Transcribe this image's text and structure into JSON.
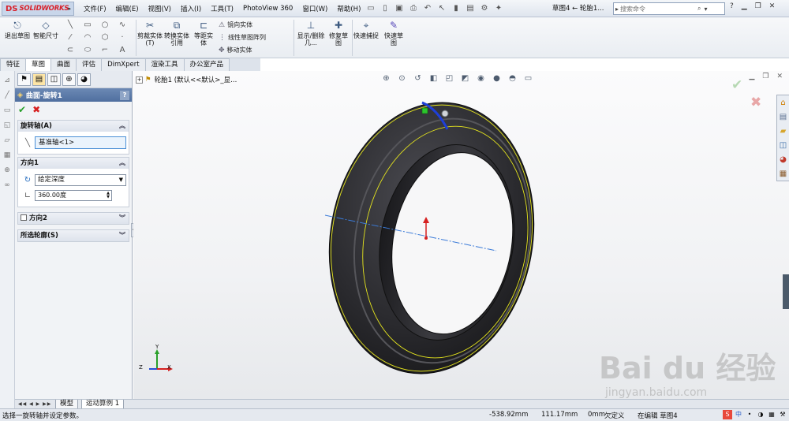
{
  "app": {
    "logo_text": "SOLIDWORKS",
    "logo_mark": "DS"
  },
  "menu": [
    "文件(F)",
    "编辑(E)",
    "视图(V)",
    "插入(I)",
    "工具(T)",
    "PhotoView 360",
    "窗口(W)",
    "帮助(H)"
  ],
  "document_title": "草图4 ← 轮胎1...",
  "search": {
    "placeholder": "搜索命令"
  },
  "ribbon": {
    "exit_sketch": "退出草图",
    "smart_dimension": "智能尺寸",
    "trim_entities": "剪裁实体(T)",
    "convert_entities": "转换实体引用",
    "offset_entities": "等距实体",
    "mirror_entities": "镜向实体",
    "linear_pattern": "线性草图阵列",
    "move_entities": "移动实体",
    "display_delete_relations": "显示/删除几...",
    "repair_sketch": "修复草图",
    "quick_snaps": "快速捕捉",
    "rapid_sketch": "快速草图"
  },
  "tabs": [
    "特征",
    "草图",
    "曲面",
    "评估",
    "DimXpert",
    "渲染工具",
    "办公室产品"
  ],
  "active_tab": "草图",
  "property_manager": {
    "title": "曲面-旋转1",
    "help": "?",
    "rotation_axis": {
      "header": "旋转轴(A)",
      "value": "基准轴<1>"
    },
    "direction1": {
      "header": "方向1",
      "type": "给定深度",
      "angle": "360.00度"
    },
    "direction2": {
      "header": "方向2"
    },
    "selected_contours": {
      "header": "所选轮廓(S)"
    }
  },
  "feature_tree": {
    "root": "轮胎1  (默认<<默认>_显..."
  },
  "triad": {
    "x": "X",
    "y": "Y",
    "z": "Z"
  },
  "watermark": {
    "main": "Bai du 经验",
    "sub": "jingyan.baidu.com"
  },
  "bottom_tabs": [
    "模型",
    "运动算例 1"
  ],
  "status": {
    "message": "选择一旋转轴并设定参数。",
    "x": "-538.92mm",
    "y": "111.17mm",
    "z": "0mm",
    "definition": "欠定义",
    "editing": "在编辑 草图4"
  },
  "colors": {
    "pm_header": "#5a78a8",
    "tire_body": "#232326",
    "tire_edge": "#e6e61e",
    "axis_line": "#3b7bd8",
    "ok_green": "#27a02a",
    "cancel_red": "#d62020"
  }
}
